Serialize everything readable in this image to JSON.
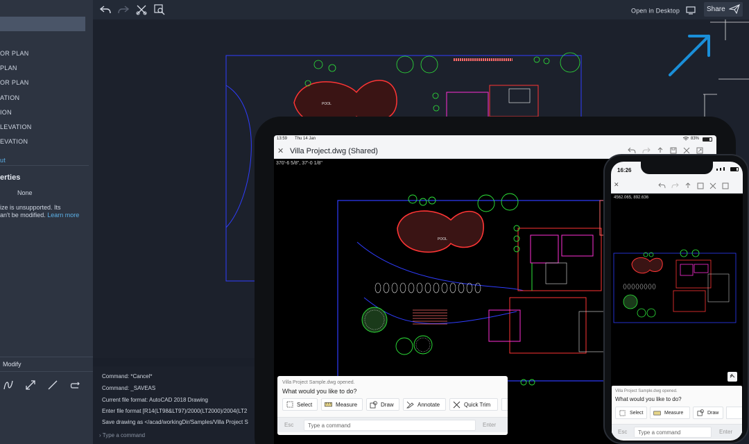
{
  "colors": {
    "accent": "#1a8fd9",
    "cad_green": "#2ee83a",
    "cad_magenta": "#ff2fd6",
    "cad_red": "#ff3535",
    "cad_blue": "#2f3dff",
    "cad_white": "#e6e6e6"
  },
  "desktop": {
    "sidebar": {
      "layouts": [
        "OR PLAN",
        "PLAN",
        "OR PLAN",
        "ATION",
        "ION",
        "LEVATION",
        "EVATION"
      ],
      "layout_link": "ut",
      "properties_title": "erties",
      "property_value": "None",
      "note_line1": "ize is unsupported. Its",
      "note_line2": "an't be modified.",
      "learn_more": "Learn more",
      "modify_label": "Modify"
    },
    "toolbar": {
      "undo_icon": "undo-icon",
      "redo_icon": "redo-icon",
      "open_in_desktop": "Open in Desktop",
      "share_label": "Share"
    },
    "command_history": [
      "Command: *Cancel*",
      "Command: _SAVEAS",
      "Current file format: AutoCAD 2018 Drawing",
      "Enter file format [R14(LT98&LT97)/2000(LT2000)/2004(LT2",
      "Save drawing as </acad/workingDir/Samples/Villa Project S"
    ],
    "command_placeholder": "Type a command"
  },
  "tablet": {
    "status_time": "13:59",
    "status_date": "Thu 14 Jan",
    "battery": "83%",
    "title": "Villa Project.dwg (Shared)",
    "coords": "370'-6 5/8\", 37'-0 1/8\"",
    "panel": {
      "opened": "Villa Project Sample.dwg opened.",
      "question": "What would you like to do?",
      "chips": [
        "Select",
        "Measure",
        "Draw",
        "Annotate",
        "Quick Trim"
      ],
      "esc": "Esc",
      "placeholder": "Type a command",
      "enter": "Enter"
    }
  },
  "phone": {
    "status_time": "16:26",
    "coords": "4562.065, 892.636",
    "panel": {
      "opened": "Villa Project Sample.dwg opened.",
      "question": "What would you like to do?",
      "chips": [
        "Select",
        "Measure",
        "Draw"
      ],
      "esc": "Esc",
      "placeholder": "Type a command",
      "enter": "Enter"
    }
  }
}
